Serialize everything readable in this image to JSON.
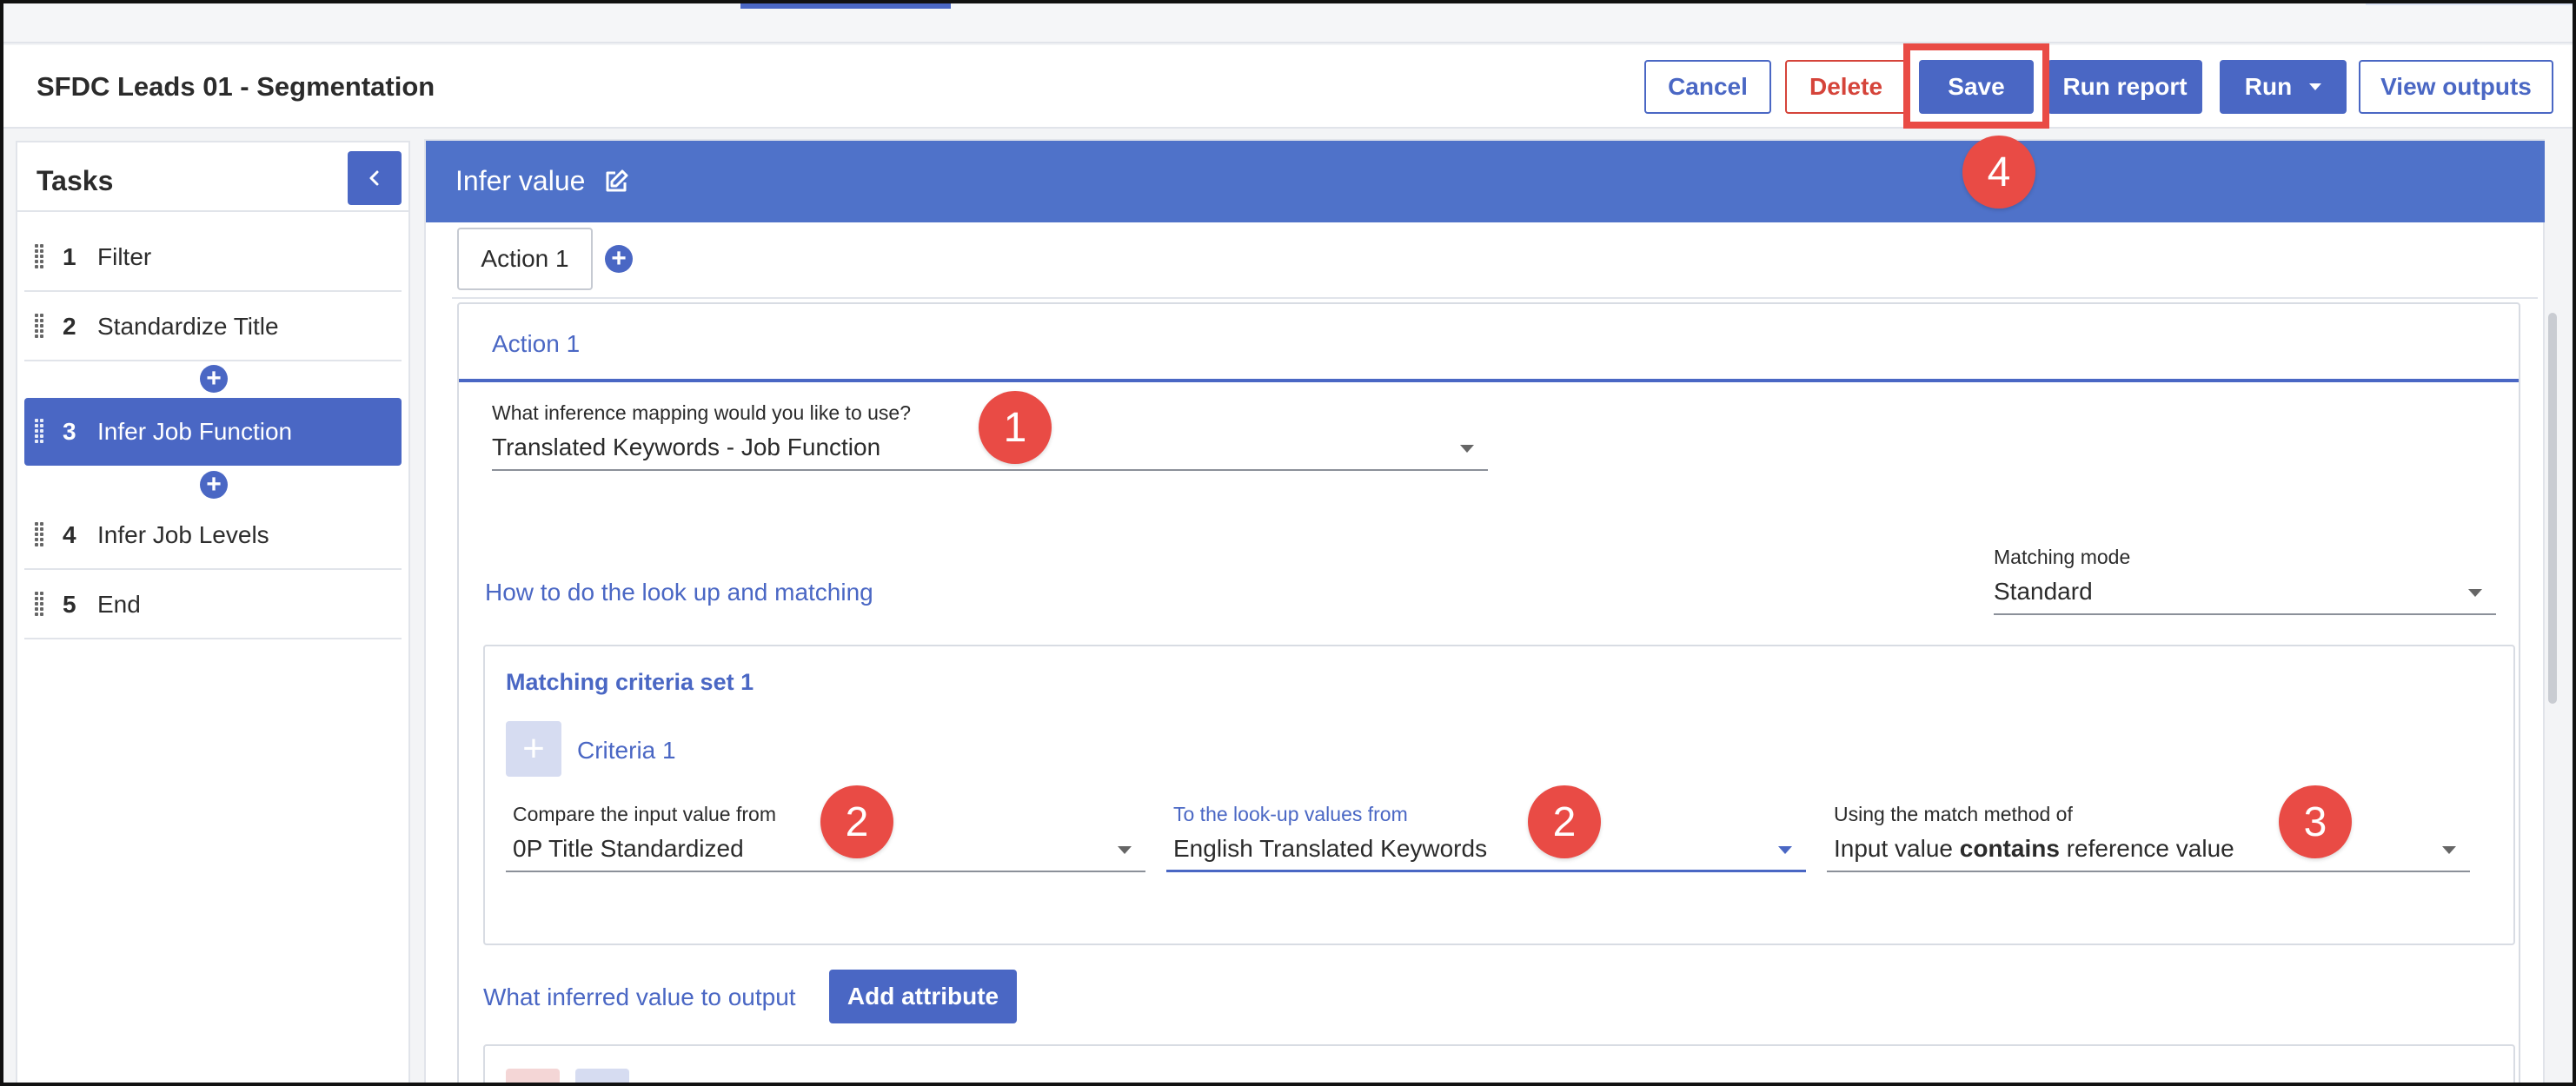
{
  "header": {
    "title": "SFDC Leads 01 - Segmentation",
    "buttons": {
      "cancel": "Cancel",
      "delete": "Delete",
      "save": "Save",
      "run_report": "Run report",
      "run": "Run",
      "view_outputs": "View outputs"
    }
  },
  "sidebar": {
    "title": "Tasks",
    "collapse_icon": "chevron-left-icon",
    "tasks": [
      {
        "num": "1",
        "label": "Filter"
      },
      {
        "num": "2",
        "label": "Standardize Title"
      },
      {
        "num": "3",
        "label": "Infer Job Function"
      },
      {
        "num": "4",
        "label": "Infer Job Levels"
      },
      {
        "num": "5",
        "label": "End"
      }
    ],
    "active_task": 3,
    "add_icon": "+"
  },
  "main": {
    "title": "Infer value",
    "tabs": [
      {
        "label": "Action 1"
      }
    ],
    "add_tab_icon": "+",
    "card": {
      "tab_label": "Action 1",
      "mapping_question": "What inference mapping would you like to use?",
      "mapping_value": "Translated Keywords - Job Function",
      "lookup_section": "How to do the look up and matching",
      "matching_mode_label": "Matching mode",
      "matching_mode_value": "Standard",
      "criteria_set_title": "Matching criteria set 1",
      "criteria_name": "Criteria 1",
      "criteria_plus": "+",
      "compare_label": "Compare the input value from",
      "compare_value": "0P Title Standardized",
      "lookup_label": "To the look-up values from",
      "lookup_value": "English Translated Keywords",
      "method_label": "Using the match method of",
      "method_value_prefix": "Input value ",
      "method_value_bold": "contains",
      "method_value_suffix": " reference value",
      "output_label": "What inferred value to output",
      "add_attribute": "Add attribute"
    }
  },
  "markers": [
    "1",
    "2",
    "2",
    "3",
    "4"
  ],
  "colors": {
    "accent": "#4a67c4",
    "header_band": "#4f72c9",
    "danger": "#d5443a",
    "marker": "#e94b45"
  }
}
